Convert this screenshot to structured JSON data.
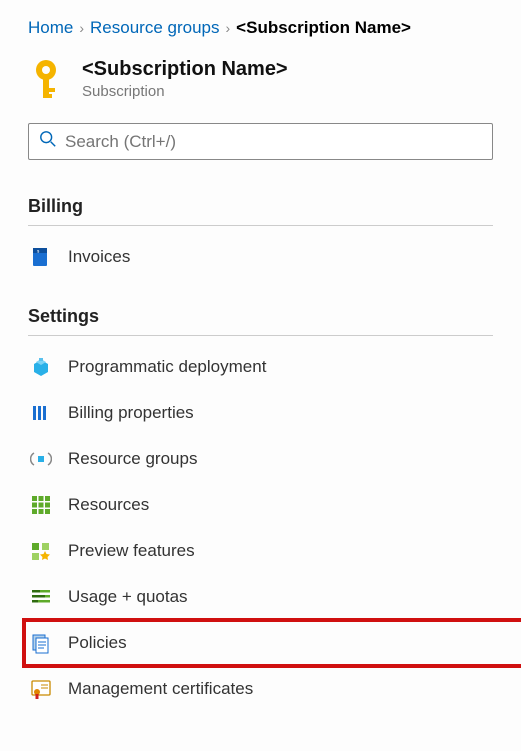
{
  "breadcrumb": {
    "home": "Home",
    "resource_groups": "Resource groups",
    "current": "<Subscription Name>"
  },
  "header": {
    "title": "<Subscription Name>",
    "subtitle": "Subscription"
  },
  "search": {
    "placeholder": "Search (Ctrl+/)"
  },
  "sections": {
    "billing": {
      "title": "Billing",
      "items": [
        {
          "label": "Invoices"
        }
      ]
    },
    "settings": {
      "title": "Settings",
      "items": [
        {
          "label": "Programmatic deployment"
        },
        {
          "label": "Billing properties"
        },
        {
          "label": "Resource groups"
        },
        {
          "label": "Resources"
        },
        {
          "label": "Preview features"
        },
        {
          "label": "Usage + quotas"
        },
        {
          "label": "Policies"
        },
        {
          "label": "Management certificates"
        }
      ]
    }
  }
}
